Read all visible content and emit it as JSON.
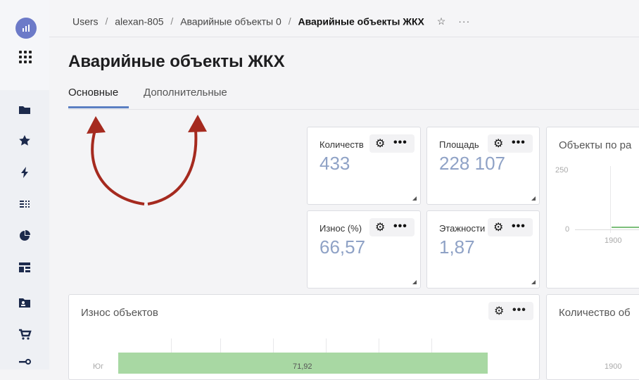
{
  "breadcrumb": {
    "items": [
      "Users",
      "alexan-805",
      "Аварийные объекты 0"
    ],
    "current": "Аварийные объекты ЖКХ",
    "separator": "/"
  },
  "page": {
    "title": "Аварийные объекты ЖКХ",
    "tabs": [
      "Основные",
      "Дополнительные"
    ]
  },
  "cards": [
    {
      "label": "Количеств",
      "value": "433"
    },
    {
      "label": "Площадь",
      "value": "228 107"
    },
    {
      "label": "Износ (%)",
      "value": "66,57"
    },
    {
      "label": "Этажности",
      "value": "1,87"
    }
  ],
  "charts": {
    "objects_by": {
      "title": "Объекты по ра",
      "ytick": "250",
      "ytick0": "0",
      "xtick": "1900"
    },
    "wear": {
      "title": "Износ объектов",
      "category": "Юг",
      "bar_value": "71,92"
    },
    "count": {
      "title": "Количество об",
      "xtick": "1900"
    }
  },
  "icons": {
    "gear": "⚙",
    "more": "•••",
    "star": "☆",
    "crumb_more": "···"
  },
  "colors": {
    "accent": "#5b7fc2",
    "value": "#8fa2c6",
    "arrow": "#a52a1f",
    "bar": "#a8d8a3"
  }
}
